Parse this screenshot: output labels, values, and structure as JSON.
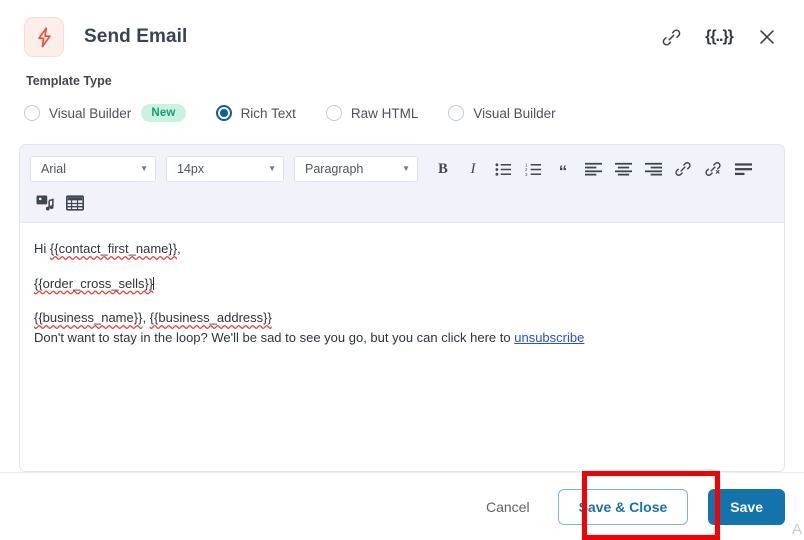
{
  "header": {
    "title": "Send Email",
    "icon": "lightning-bolt-icon",
    "bolt_color": "#e2543a",
    "bolt_bg": "#fdeeec",
    "actions": [
      {
        "name": "link-icon",
        "label": "link"
      },
      {
        "name": "merge-tag-icon",
        "label": "{{..}}"
      },
      {
        "name": "close-icon",
        "label": "close"
      }
    ]
  },
  "template_type": {
    "label": "Template Type",
    "options": [
      {
        "label": "Visual Builder",
        "selected": false,
        "badge": "New"
      },
      {
        "label": "Rich Text",
        "selected": true,
        "badge": ""
      },
      {
        "label": "Raw HTML",
        "selected": false,
        "badge": ""
      },
      {
        "label": "Visual Builder",
        "selected": false,
        "badge": ""
      }
    ],
    "accent": "#0b5ea8",
    "badge_bg": "#c9f3e0",
    "badge_fg": "#1b9b76"
  },
  "editor": {
    "toolbar": {
      "font_family": "Arial",
      "font_size": "14px",
      "block_format": "Paragraph",
      "buttons_row1": [
        {
          "name": "bold-icon",
          "label": "B"
        },
        {
          "name": "italic-icon",
          "label": "I"
        },
        {
          "name": "bullet-list-icon",
          "label": "bullet list"
        },
        {
          "name": "numbered-list-icon",
          "label": "numbered list"
        },
        {
          "name": "blockquote-icon",
          "label": "“"
        },
        {
          "name": "align-left-icon",
          "label": "align left"
        },
        {
          "name": "align-center-icon",
          "label": "align center"
        },
        {
          "name": "align-right-icon",
          "label": "align right"
        },
        {
          "name": "insert-link-icon",
          "label": "insert link"
        },
        {
          "name": "unlink-icon",
          "label": "unlink"
        },
        {
          "name": "horizontal-rule-icon",
          "label": "horizontal rule"
        }
      ],
      "buttons_row2": [
        {
          "name": "insert-media-icon",
          "label": "insert media"
        },
        {
          "name": "insert-table-icon",
          "label": "insert table"
        }
      ]
    },
    "content": {
      "line1_prefix": "Hi ",
      "line1_tag": "{{contact_first_name}}",
      "line1_suffix": ",",
      "line2_tag": "{{order_cross_sells}}",
      "line3_tag_a": "{{business_name}}",
      "line3_sep": ", ",
      "line3_tag_b": "{{business_address}}",
      "line4_text": "Don't want to stay in the loop? We'll be sad to see you go, but you can click here to ",
      "line4_link": "unsubscribe"
    }
  },
  "footer": {
    "cancel_label": "Cancel",
    "save_close_label": "Save & Close",
    "save_label": "Save",
    "save_bg": "#1274ab",
    "save_close_fg": "#1673ad",
    "annotation_color": "#f50000"
  },
  "watermark": {
    "corner_letter": "A"
  }
}
